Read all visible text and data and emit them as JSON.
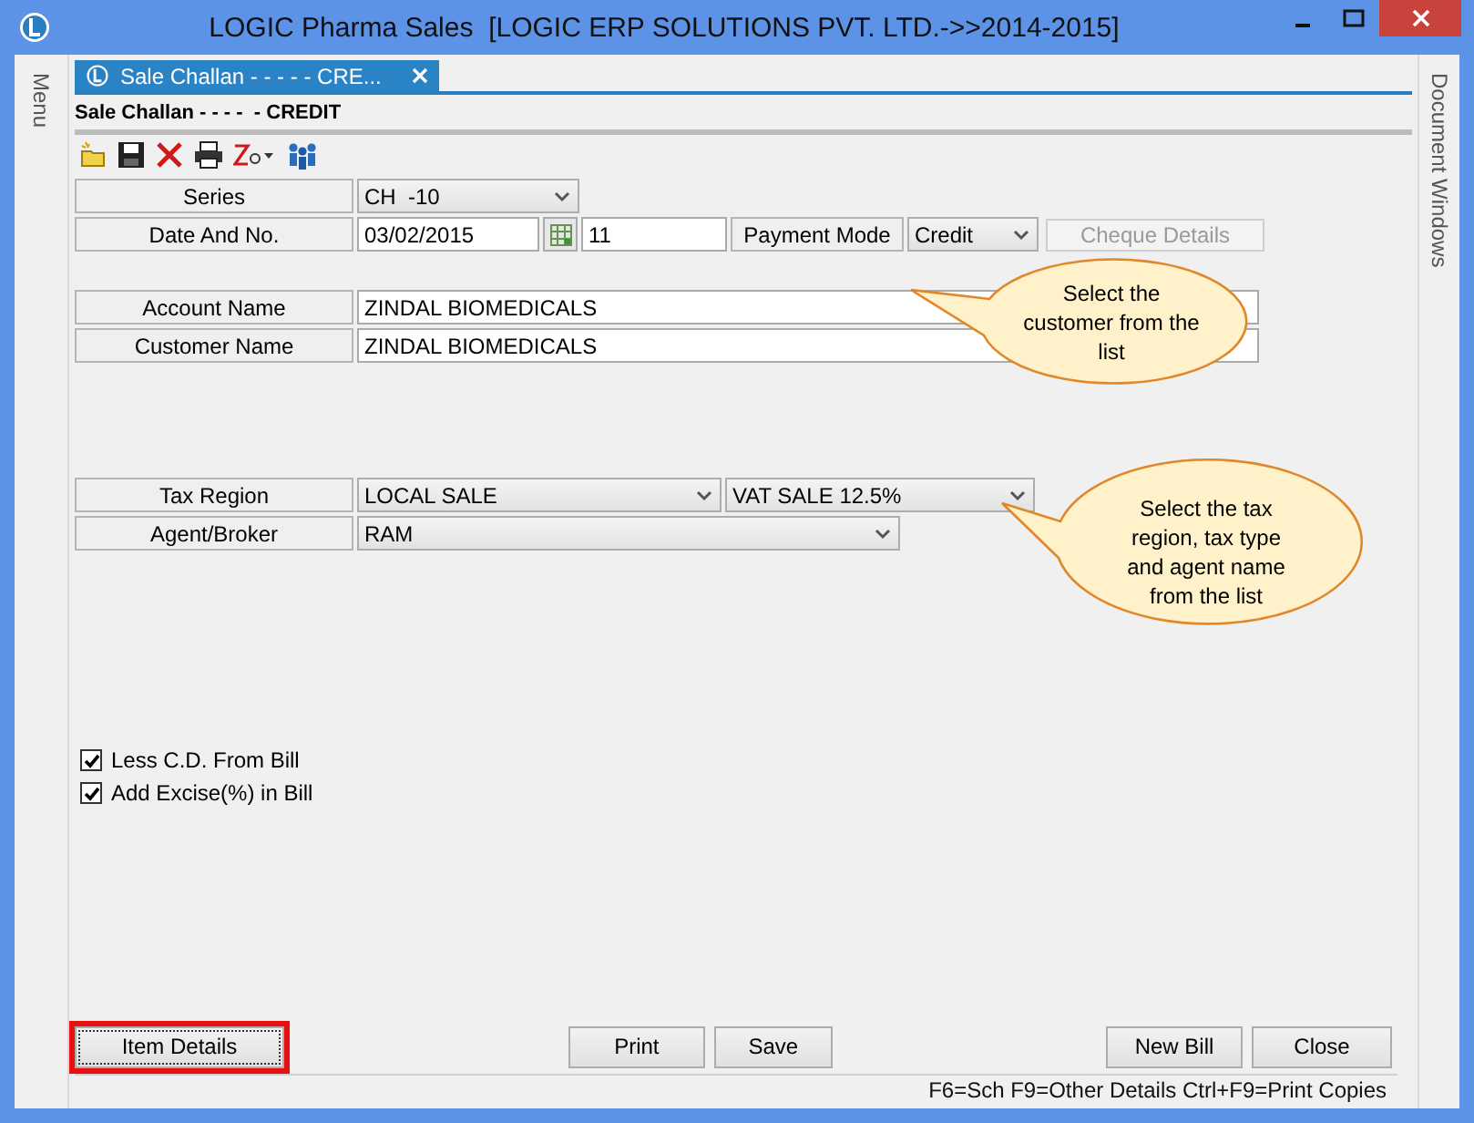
{
  "window": {
    "title": "LOGIC Pharma Sales  [LOGIC ERP SOLUTIONS PVT. LTD.->>2014-2015]"
  },
  "side_panels": {
    "left": "Menu",
    "right": "Document Windows"
  },
  "document_tab": {
    "label": "Sale Challan - - - - - CRE...",
    "selected": true
  },
  "form_title": "Sale Challan - - - -  - CREDIT",
  "toolbar": [
    {
      "kind": "new"
    },
    {
      "kind": "save"
    },
    {
      "kind": "delete"
    },
    {
      "kind": "print"
    },
    {
      "kind": "zoom"
    },
    {
      "kind": "users"
    }
  ],
  "series": {
    "label": "Series",
    "value": "CH  -10"
  },
  "date_and_no": {
    "label": "Date And No.",
    "date": "03/02/2015",
    "number": "11"
  },
  "payment_mode": {
    "label": "Payment Mode",
    "value": "Credit"
  },
  "cheque_details": {
    "label": "Cheque Details",
    "disabled": true
  },
  "account_name": {
    "label": "Account Name",
    "value": "ZINDAL BIOMEDICALS"
  },
  "customer_name": {
    "label": "Customer Name",
    "value": "ZINDAL BIOMEDICALS"
  },
  "tax_region": {
    "label": "Tax Region",
    "value": "LOCAL SALE",
    "tax_type": "VAT SALE 12.5%"
  },
  "agent_broker": {
    "label": "Agent/Broker",
    "value": "RAM"
  },
  "options": [
    {
      "label": "Less C.D. From Bill",
      "checked": true
    },
    {
      "label": "Add Excise(%) in Bill",
      "checked": true
    }
  ],
  "callouts": [
    {
      "text": "Select the customer from the list"
    },
    {
      "text": "Select the tax region, tax type and agent name from the list"
    }
  ],
  "buttons": {
    "left": [
      {
        "label": "Item Details",
        "highlighted": true
      }
    ],
    "center": [
      {
        "label": "Print",
        "highlighted": false
      },
      {
        "label": "Save",
        "highlighted": false
      }
    ],
    "right": [
      {
        "label": "New Bill",
        "highlighted": false
      },
      {
        "label": "Close",
        "highlighted": false
      }
    ]
  },
  "shortcuts": "F6=Sch F9=Other Details Ctrl+F9=Print Copies"
}
